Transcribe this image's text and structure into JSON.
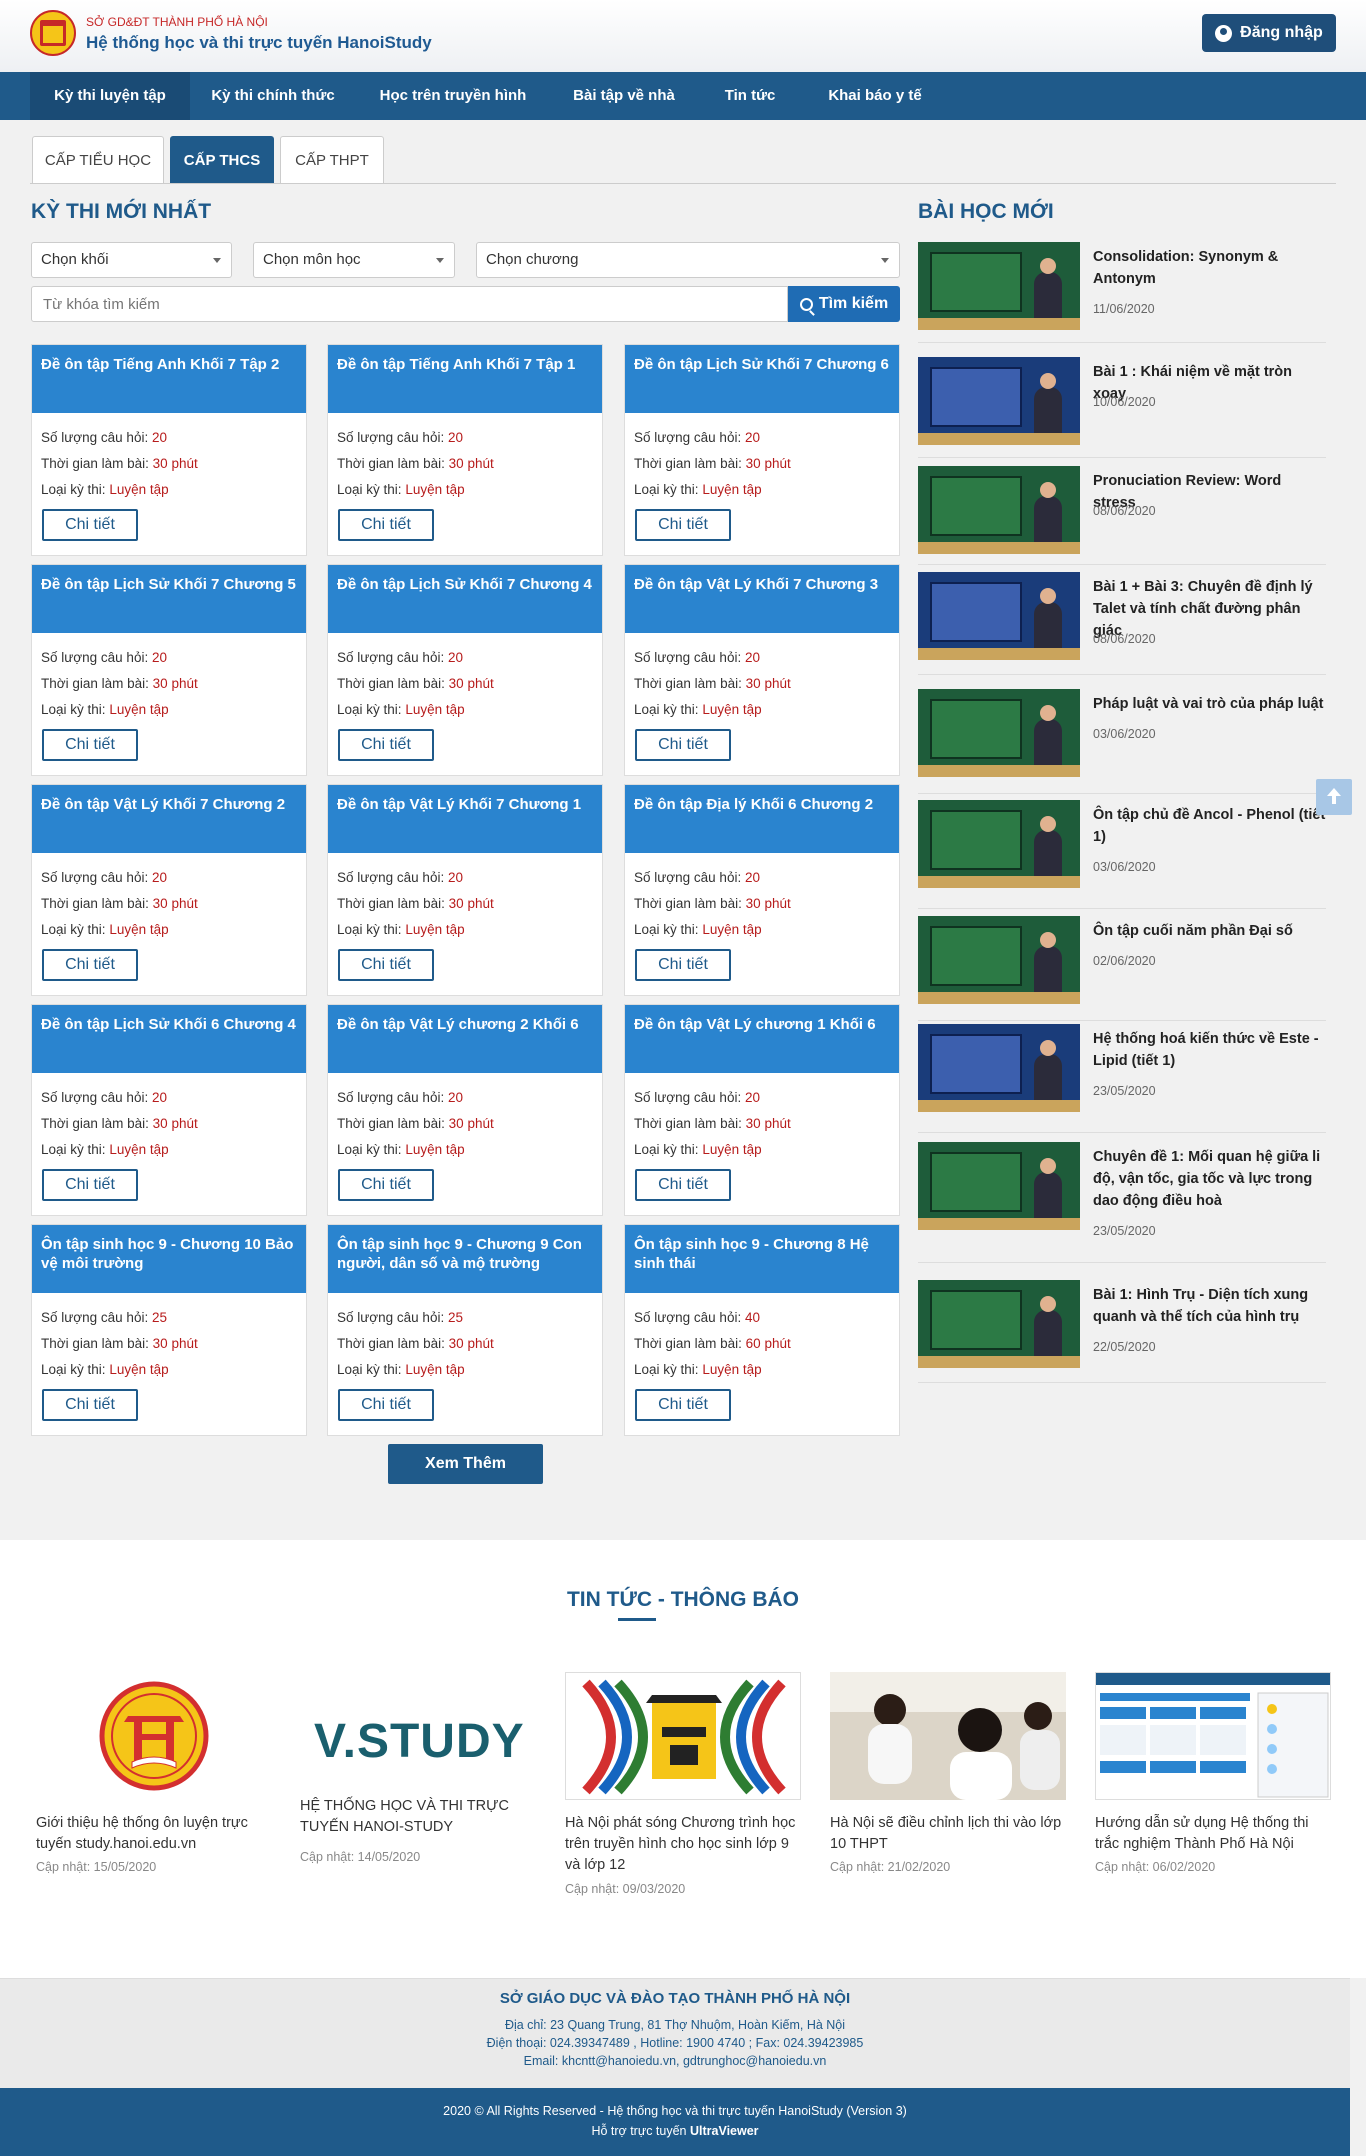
{
  "header": {
    "org_sub": "SỞ GD&ĐT THÀNH PHỐ HÀ NỘI",
    "org_main": "Hệ thống học và thi trực tuyến HanoiStudy",
    "login_label": "Đăng nhập"
  },
  "nav": {
    "items": [
      "Kỳ thi luyện tập",
      "Kỳ thi chính thức",
      "Học trên truyền hình",
      "Bài tập về nhà",
      "Tin tức",
      "Khai báo y tế"
    ]
  },
  "level_tabs": [
    "CẤP TIỂU HỌC",
    "CẤP THCS",
    "CẤP THPT"
  ],
  "exams": {
    "title": "KỲ THI MỚI NHẤT",
    "filters": [
      "Chọn khối",
      "Chọn môn học",
      "Chọn chương"
    ],
    "search_placeholder": "Từ khóa tìm kiếm",
    "search_label": "Tìm kiếm",
    "q_label": "Số lượng câu hỏi:",
    "time_label": "Thời gian làm bài:",
    "type_label": "Loại kỳ thi:",
    "detail_label": "Chi tiết",
    "more_label": "Xem Thêm",
    "cards": [
      {
        "title": "Đề ôn tập Tiếng Anh Khối 7 Tập 2",
        "questions": "20",
        "time": "30 phút",
        "type": "Luyện tập"
      },
      {
        "title": "Đề ôn tập Tiếng Anh Khối 7 Tập 1",
        "questions": "20",
        "time": "30 phút",
        "type": "Luyện tập"
      },
      {
        "title": "Đề ôn tập Lịch Sử Khối 7 Chương 6",
        "questions": "20",
        "time": "30 phút",
        "type": "Luyện tập"
      },
      {
        "title": "Đề ôn tập Lịch Sử Khối 7 Chương 5",
        "questions": "20",
        "time": "30 phút",
        "type": "Luyện tập"
      },
      {
        "title": "Đề ôn tập Lịch Sử Khối 7 Chương 4",
        "questions": "20",
        "time": "30 phút",
        "type": "Luyện tập"
      },
      {
        "title": "Đề ôn tập Vật Lý Khối 7 Chương 3",
        "questions": "20",
        "time": "30 phút",
        "type": "Luyện tập"
      },
      {
        "title": "Đề ôn tập Vật Lý Khối 7 Chương 2",
        "questions": "20",
        "time": "30 phút",
        "type": "Luyện tập"
      },
      {
        "title": "Đề ôn tập Vật Lý Khối 7 Chương 1",
        "questions": "20",
        "time": "30 phút",
        "type": "Luyện tập"
      },
      {
        "title": "Đề ôn tập Địa lý Khối 6 Chương 2",
        "questions": "20",
        "time": "30 phút",
        "type": "Luyện tập"
      },
      {
        "title": "Đề ôn tập Lịch Sử Khối 6 Chương 4",
        "questions": "20",
        "time": "30 phút",
        "type": "Luyện tập"
      },
      {
        "title": "Đề ôn tập Vật Lý chương 2 Khối 6",
        "questions": "20",
        "time": "30 phút",
        "type": "Luyện tập"
      },
      {
        "title": "Đề ôn tập Vật Lý chương 1 Khối 6",
        "questions": "20",
        "time": "30 phút",
        "type": "Luyện tập"
      },
      {
        "title": "Ôn tập sinh học 9 - Chương 10 Bảo vệ môi trường",
        "questions": "25",
        "time": "30 phút",
        "type": "Luyện tập"
      },
      {
        "title": "Ôn tập sinh học 9 - Chương 9 Con người, dân số và mộ trường",
        "questions": "25",
        "time": "30 phút",
        "type": "Luyện tập"
      },
      {
        "title": "Ôn tập sinh học 9 - Chương 8 Hệ sinh thái",
        "questions": "40",
        "time": "60 phút",
        "type": "Luyện tập"
      }
    ]
  },
  "lessons": {
    "title": "BÀI HỌC MỚI",
    "items": [
      {
        "title": "Consolidation: Synonym & Antonym",
        "date": "11/06/2020"
      },
      {
        "title": "Bài 1 : Khái niệm về mặt tròn xoay",
        "date": "10/06/2020"
      },
      {
        "title": "Pronuciation Review: Word stress",
        "date": "08/06/2020"
      },
      {
        "title": "Bài 1 + Bài 3: Chuyên đề định lý Talet và tính chất đường phân giác",
        "date": "08/06/2020"
      },
      {
        "title": "Pháp luật và vai trò của pháp luật",
        "date": "03/06/2020"
      },
      {
        "title": "Ôn tập chủ đề Ancol - Phenol (tiết 1)",
        "date": "03/06/2020"
      },
      {
        "title": "Ôn tập cuối năm phần Đại số",
        "date": "02/06/2020"
      },
      {
        "title": "Hệ thống hoá kiến thức về Este - Lipid (tiết 1)",
        "date": "23/05/2020"
      },
      {
        "title": "Chuyên đề 1: Mối quan hệ giữa li độ, vận tốc, gia tốc và lực trong dao động điều hoà",
        "date": "23/05/2020"
      },
      {
        "title": "Bài 1: Hình Trụ - Diện tích xung quanh và thể tích của hình trụ",
        "date": "22/05/2020"
      }
    ]
  },
  "news": {
    "title": "TIN TỨC - THÔNG BÁO",
    "vstudy_logo": "V.STUDY",
    "items": [
      {
        "caption": "Giới thiệu hệ thống ôn luyện trực tuyến study.hanoi.edu.vn",
        "date": "Cập nhật: 15/05/2020"
      },
      {
        "caption": "HỆ THỐNG HỌC VÀ THI TRỰC TUYẾN HANOI-STUDY",
        "date": "Cập nhật: 14/05/2020"
      },
      {
        "caption": "Hà Nội phát sóng Chương trình học trên truyền hình cho học sinh lớp 9 và lớp 12",
        "date": "Cập nhật: 09/03/2020"
      },
      {
        "caption": "Hà Nội sẽ điều chỉnh lịch thi vào lớp 10 THPT",
        "date": "Cập nhật: 21/02/2020"
      },
      {
        "caption": "Hướng dẫn sử dụng Hệ thống thi trắc nghiệm Thành Phố Hà Nội",
        "date": "Cập nhật: 06/02/2020"
      }
    ]
  },
  "footer": {
    "org": "SỞ GIÁO DỤC VÀ ĐÀO TẠO THÀNH PHỐ HÀ NỘI",
    "address": "Địa chỉ: 23 Quang Trung, 81 Thợ Nhuộm, Hoàn Kiếm, Hà Nội",
    "phone": "Điện thoại: 024.39347489 , Hotline: 1900 4740 ; Fax: 024.39423985",
    "email": "Email: khcntt@hanoiedu.vn, gdtrunghoc@hanoiedu.vn",
    "copyright": "2020 © All Rights Reserved - Hệ thống học và thi trực tuyến HanoiStudy (Version 3)",
    "support_prefix": "Hỗ trợ trực tuyến",
    "support_link": "UltraViewer"
  },
  "colors": {
    "primary": "#1f5a8a",
    "card_head": "#2a84cf",
    "accent_red": "#b71c1c"
  }
}
